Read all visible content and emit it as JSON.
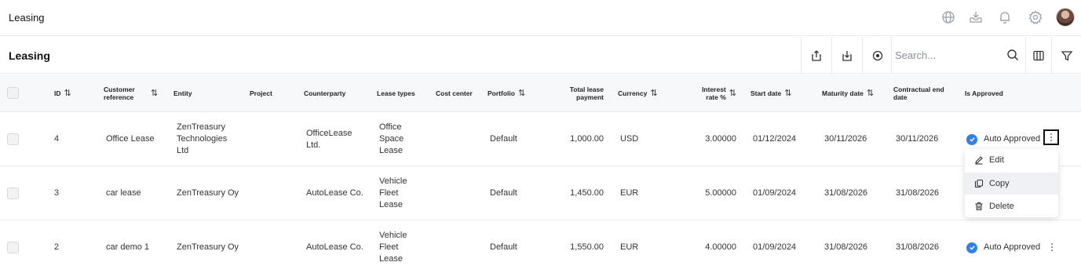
{
  "topbar": {
    "title": "Leasing",
    "icons": [
      "globe-icon",
      "inbox-download-icon",
      "bell-icon",
      "gear-icon"
    ]
  },
  "toolbar": {
    "title": "Leasing",
    "search_placeholder": "Search...",
    "buttons": [
      "upload-icon",
      "download-icon",
      "target-icon",
      "columns-icon",
      "filter-icon"
    ]
  },
  "table": {
    "columns": {
      "id": "ID",
      "customer_reference": "Customer reference",
      "entity": "Entity",
      "project": "Project",
      "counterparty": "Counterparty",
      "lease_types": "Lease types",
      "cost_center": "Cost center",
      "portfolio": "Portfolio",
      "total_lease_payment": "Total lease payment",
      "currency": "Currency",
      "interest_rate": "Interest rate %",
      "start_date": "Start date",
      "maturity_date": "Maturity date",
      "contractual_end_date": "Contractual end date",
      "is_approved": "Is Approved"
    },
    "sort_glyph": "⇅",
    "rows": [
      {
        "id": "4",
        "customer_reference": "Office Lease",
        "entity": "ZenTreasury Technologies Ltd",
        "project": "",
        "counterparty": "OfficeLease Ltd.",
        "lease_types": "Office Space Lease",
        "cost_center": "",
        "portfolio": "Default",
        "total_lease_payment": "1,000.00",
        "currency": "USD",
        "interest_rate": "3.00000",
        "start_date": "01/12/2024",
        "maturity_date": "30/11/2026",
        "contractual_end_date": "30/11/2026",
        "is_approved": "Auto Approved"
      },
      {
        "id": "3",
        "customer_reference": "car lease",
        "entity": "ZenTreasury Oy",
        "project": "",
        "counterparty": "AutoLease Co.",
        "lease_types": "Vehicle Fleet Lease",
        "cost_center": "",
        "portfolio": "Default",
        "total_lease_payment": "1,450.00",
        "currency": "EUR",
        "interest_rate": "5.00000",
        "start_date": "01/09/2024",
        "maturity_date": "31/08/2026",
        "contractual_end_date": "31/08/2026",
        "is_approved": ""
      },
      {
        "id": "2",
        "customer_reference": "car demo 1",
        "entity": "ZenTreasury Oy",
        "project": "",
        "counterparty": "AutoLease Co.",
        "lease_types": "Vehicle Fleet Lease",
        "cost_center": "",
        "portfolio": "Default",
        "total_lease_payment": "1,550.00",
        "currency": "EUR",
        "interest_rate": "4.00000",
        "start_date": "01/09/2024",
        "maturity_date": "31/08/2026",
        "contractual_end_date": "31/08/2026",
        "is_approved": "Auto Approved"
      }
    ]
  },
  "row_menu": {
    "items": [
      {
        "label": "Edit",
        "icon": "edit-icon"
      },
      {
        "label": "Copy",
        "icon": "copy-icon"
      },
      {
        "label": "Delete",
        "icon": "trash-icon"
      }
    ]
  },
  "colors": {
    "accent": "#2f80ed",
    "header_bg": "#f7f8fa",
    "border": "#e8eaee"
  }
}
